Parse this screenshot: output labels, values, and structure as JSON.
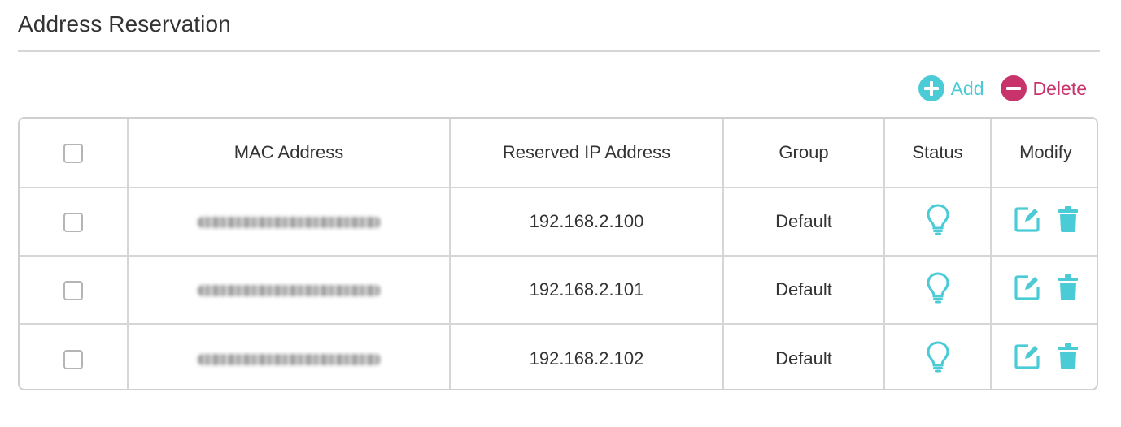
{
  "section": {
    "title": "Address Reservation"
  },
  "toolbar": {
    "add_label": "Add",
    "delete_label": "Delete",
    "add_color": "#4acbd6",
    "delete_color": "#c7336a",
    "add_icon": "plus-circle-icon",
    "delete_icon": "minus-circle-icon"
  },
  "table": {
    "headers": {
      "mac": "MAC Address",
      "ip": "Reserved IP Address",
      "group": "Group",
      "status": "Status",
      "modify": "Modify"
    },
    "rows": [
      {
        "mac": "",
        "ip": "192.168.2.100",
        "group": "Default",
        "status_icon": "lightbulb-icon",
        "enabled": true
      },
      {
        "mac": "",
        "ip": "192.168.2.101",
        "group": "Default",
        "status_icon": "lightbulb-icon",
        "enabled": true
      },
      {
        "mac": "",
        "ip": "192.168.2.102",
        "group": "Default",
        "status_icon": "lightbulb-icon",
        "enabled": true
      }
    ],
    "icon_color": "#4acbd6",
    "modify_icons": [
      "edit-icon",
      "trash-icon"
    ]
  }
}
